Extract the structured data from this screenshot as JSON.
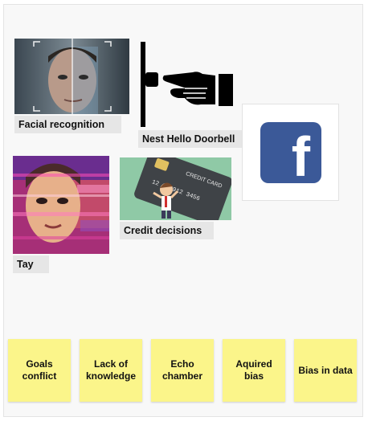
{
  "board": {
    "cards": {
      "facial_recognition": {
        "label": "Facial recognition",
        "icon": "face-scan-image"
      },
      "nest_hello": {
        "label": "Nest Hello Doorbell",
        "icon": "doorbell-hand-image"
      },
      "facebook": {
        "icon": "facebook-logo",
        "glyph": "f",
        "color": "#3b5998"
      },
      "tay": {
        "label": "Tay",
        "icon": "glitch-face-image"
      },
      "credit_decisions": {
        "label": "Credit decisions",
        "icon": "credit-card-image",
        "card_text": "CREDIT CARD",
        "card_number": "12 3 D912 3456"
      }
    },
    "stickies": [
      {
        "text": "Goals conflict"
      },
      {
        "text": "Lack of knowledge"
      },
      {
        "text": "Echo chamber"
      },
      {
        "text": "Aquired bias"
      },
      {
        "text": "Bias in data"
      }
    ]
  }
}
